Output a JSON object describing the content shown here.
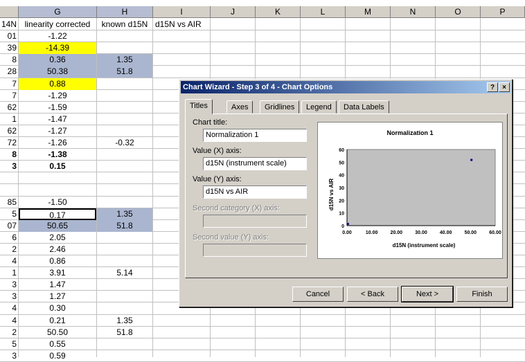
{
  "columns": [
    "G",
    "H",
    "I",
    "J",
    "K",
    "L",
    "M",
    "N",
    "O",
    "P"
  ],
  "rows": [
    {
      "f": "14N",
      "g": "linearity corrected",
      "h": "known d15N",
      "i": "d15N vs AIR"
    },
    {
      "f": "01",
      "g": "-1.22",
      "h": "",
      "i": ""
    },
    {
      "f": "39",
      "g": "-14.39",
      "h": "",
      "i": ""
    },
    {
      "f": "8",
      "g": "0.36",
      "h": "1.35",
      "i": ""
    },
    {
      "f": "28",
      "g": "50.38",
      "h": "51.8",
      "i": ""
    },
    {
      "f": "7",
      "g": "0.88",
      "h": "",
      "i": ""
    },
    {
      "f": "7",
      "g": "-1.29",
      "h": "",
      "i": ""
    },
    {
      "f": "62",
      "g": "-1.59",
      "h": "",
      "i": ""
    },
    {
      "f": "1",
      "g": "-1.47",
      "h": "",
      "i": ""
    },
    {
      "f": "62",
      "g": "-1.27",
      "h": "",
      "i": ""
    },
    {
      "f": "72",
      "g": "-1.26",
      "h": "-0.32",
      "i": ""
    },
    {
      "f": "8",
      "g": "-1.38",
      "h": "",
      "i": ""
    },
    {
      "f": "3",
      "g": "0.15",
      "h": "",
      "i": ""
    },
    {
      "f": "",
      "g": "",
      "h": "",
      "i": ""
    },
    {
      "f": "",
      "g": "",
      "h": "",
      "i": ""
    },
    {
      "f": "85",
      "g": "-1.50",
      "h": "",
      "i": ""
    },
    {
      "f": "5",
      "g": "0.17",
      "h": "1.35",
      "i": ""
    },
    {
      "f": "07",
      "g": "50.65",
      "h": "51.8",
      "i": ""
    },
    {
      "f": "6",
      "g": "2.05",
      "h": "",
      "i": ""
    },
    {
      "f": "2",
      "g": "2.46",
      "h": "",
      "i": ""
    },
    {
      "f": "4",
      "g": "0.86",
      "h": "",
      "i": ""
    },
    {
      "f": "1",
      "g": "3.91",
      "h": "5.14",
      "i": ""
    },
    {
      "f": "3",
      "g": "1.47",
      "h": "",
      "i": ""
    },
    {
      "f": "3",
      "g": "1.27",
      "h": "",
      "i": ""
    },
    {
      "f": "4",
      "g": "0.30",
      "h": "",
      "i": ""
    },
    {
      "f": "4",
      "g": "0.21",
      "h": "1.35",
      "i": ""
    },
    {
      "f": "2",
      "g": "50.50",
      "h": "51.8",
      "i": ""
    },
    {
      "f": "5",
      "g": "0.55",
      "h": "",
      "i": ""
    },
    {
      "f": "3",
      "g": "0.59",
      "h": "",
      "i": ""
    }
  ],
  "dialog": {
    "title": "Chart Wizard - Step 3 of 4 - Chart Options",
    "help_label": "?",
    "close_label": "×",
    "tabs": [
      "Titles",
      "Axes",
      "Gridlines",
      "Legend",
      "Data Labels"
    ],
    "chart_title_label": "Chart title:",
    "chart_title_value": "Normalization 1",
    "x_axis_label": "Value (X) axis:",
    "x_axis_value": "d15N (instrument scale)",
    "y_axis_label": "Value (Y) axis:",
    "y_axis_value": "d15N vs AIR",
    "second_x_label": "Second category (X) axis:",
    "second_y_label": "Second value (Y) axis:",
    "buttons": {
      "cancel": "Cancel",
      "back": "< Back",
      "next": "Next >",
      "finish": "Finish"
    }
  },
  "chart_data": {
    "type": "scatter",
    "title": "Normalization 1",
    "xlabel": "d15N (instrument scale)",
    "ylabel": "d15N vs AIR",
    "xlim": [
      0,
      60
    ],
    "ylim": [
      0,
      60
    ],
    "xticks": [
      "0.00",
      "10.00",
      "20.00",
      "30.00",
      "40.00",
      "50.00",
      "60.00"
    ],
    "yticks": [
      "0",
      "10",
      "20",
      "30",
      "40",
      "50",
      "60"
    ],
    "points": [
      {
        "x": 0.36,
        "y": 1.35
      },
      {
        "x": 50.38,
        "y": 51.8
      }
    ],
    "marker_color": "#000080",
    "plot_background": "#c0c0c0",
    "grid": false
  }
}
